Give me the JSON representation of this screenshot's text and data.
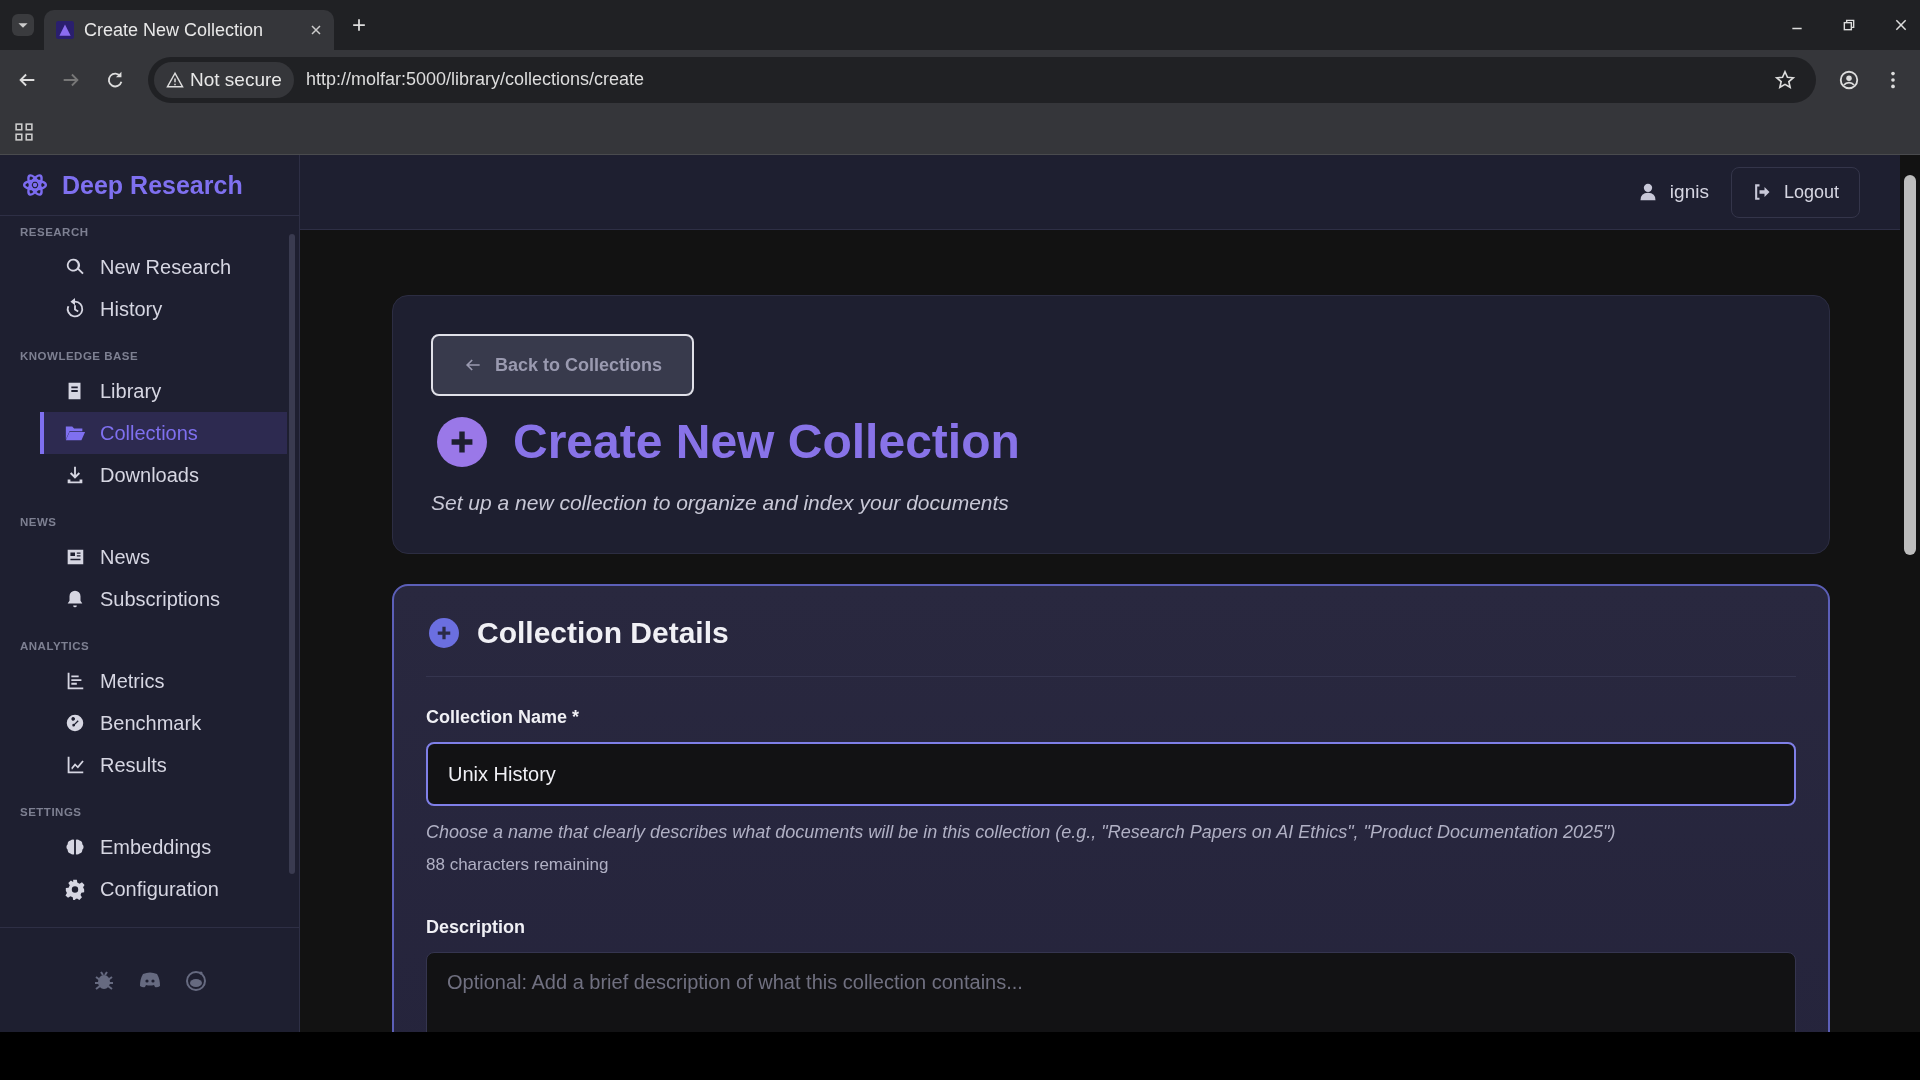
{
  "browser": {
    "tab_title": "Create New Collection",
    "security": "Not secure",
    "url": "http://molfar:5000/library/collections/create"
  },
  "sidebar": {
    "brand": "Deep Research",
    "sections": [
      {
        "title": "RESEARCH",
        "items": [
          {
            "label": "New Research",
            "selected": false
          },
          {
            "label": "History",
            "selected": false
          }
        ]
      },
      {
        "title": "KNOWLEDGE BASE",
        "items": [
          {
            "label": "Library",
            "selected": false
          },
          {
            "label": "Collections",
            "selected": true
          },
          {
            "label": "Downloads",
            "selected": false
          }
        ]
      },
      {
        "title": "NEWS",
        "items": [
          {
            "label": "News",
            "selected": false
          },
          {
            "label": "Subscriptions",
            "selected": false
          }
        ]
      },
      {
        "title": "ANALYTICS",
        "items": [
          {
            "label": "Metrics",
            "selected": false
          },
          {
            "label": "Benchmark",
            "selected": false
          },
          {
            "label": "Results",
            "selected": false
          }
        ]
      },
      {
        "title": "SETTINGS",
        "items": [
          {
            "label": "Embeddings",
            "selected": false
          },
          {
            "label": "Configuration",
            "selected": false
          }
        ]
      }
    ]
  },
  "header": {
    "user": "ignis",
    "logout": "Logout"
  },
  "page": {
    "back": "Back to Collections",
    "title": "Create New Collection",
    "subtitle": "Set up a new collection to organize and index your documents"
  },
  "form": {
    "title": "Collection Details",
    "name_label": "Collection Name *",
    "name_value": "Unix History",
    "name_help": "Choose a name that clearly describes what documents will be in this collection (e.g., \"Research Papers on AI Ethics\", \"Product Documentation 2025\")",
    "name_remaining": "88 characters remaining",
    "description_label": "Description",
    "description_placeholder": "Optional: Add a brief description of what this collection contains..."
  }
}
